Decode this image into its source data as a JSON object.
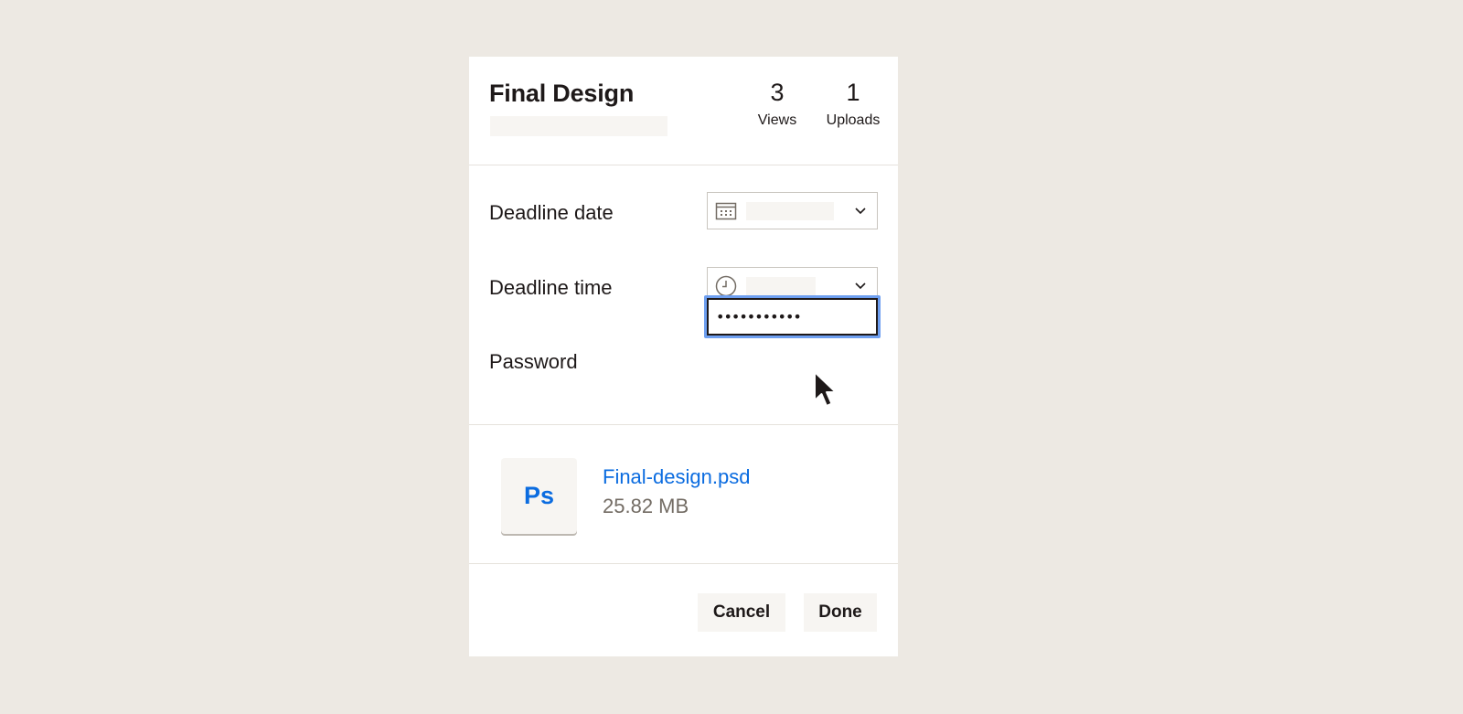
{
  "header": {
    "title": "Final Design",
    "stats": [
      {
        "value": "3",
        "label": "Views"
      },
      {
        "value": "1",
        "label": "Uploads"
      }
    ]
  },
  "form": {
    "deadline_date": {
      "label": "Deadline date",
      "icon": "calendar-icon"
    },
    "deadline_time": {
      "label": "Deadline time",
      "icon": "clock-icon"
    },
    "password": {
      "label": "Password",
      "value": "•••••••••••"
    }
  },
  "file": {
    "thumb_text": "Ps",
    "name": "Final-design.psd",
    "size": "25.82 MB"
  },
  "actions": {
    "cancel_label": "Cancel",
    "done_label": "Done"
  },
  "colors": {
    "background": "#ede9e3",
    "link": "#0b6ce0",
    "focus_ring": "#6e9ff0"
  }
}
